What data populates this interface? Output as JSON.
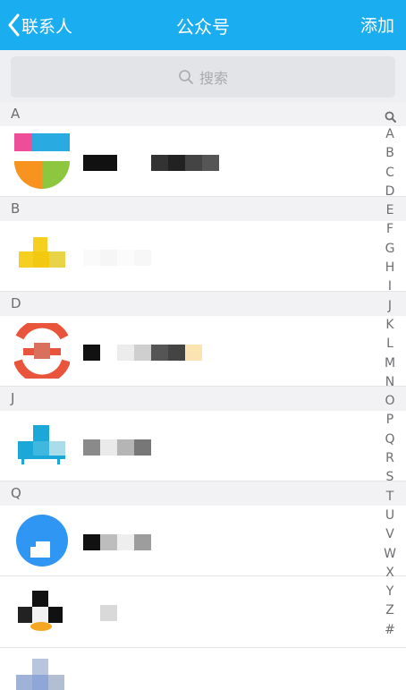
{
  "header": {
    "back_label": "联系人",
    "title": "公众号",
    "add_label": "添加"
  },
  "search": {
    "placeholder": "搜索"
  },
  "sections": [
    {
      "letter": "A"
    },
    {
      "letter": "B"
    },
    {
      "letter": "D"
    },
    {
      "letter": "J"
    },
    {
      "letter": "Q"
    }
  ],
  "index_bar": [
    "A",
    "B",
    "C",
    "D",
    "E",
    "F",
    "G",
    "H",
    "I",
    "J",
    "K",
    "L",
    "M",
    "N",
    "O",
    "P",
    "Q",
    "R",
    "S",
    "T",
    "U",
    "V",
    "W",
    "X",
    "Y",
    "Z",
    "#"
  ],
  "colors": {
    "header_bg": "#1aadf0",
    "section_bg": "#f2f2f4",
    "search_bg": "#e3e4e7"
  }
}
